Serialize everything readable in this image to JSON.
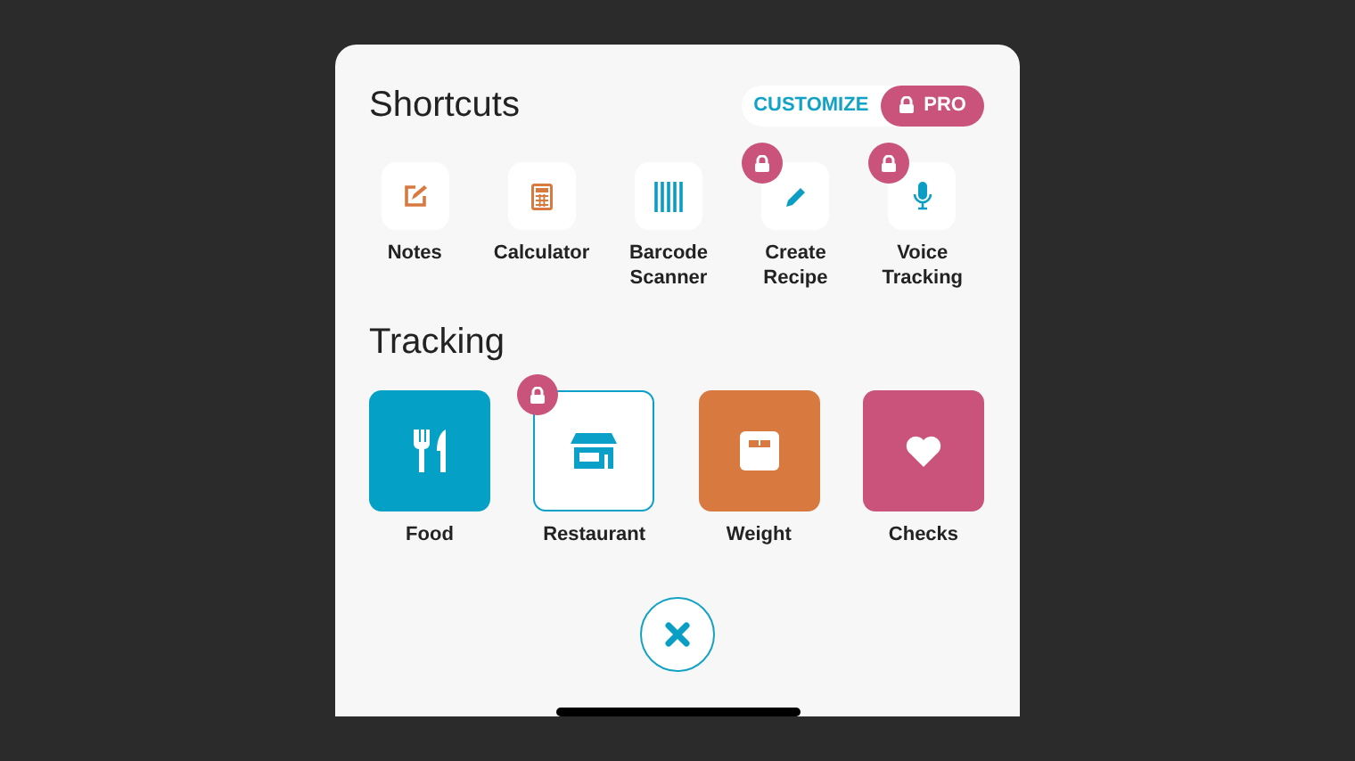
{
  "shortcuts": {
    "title": "Shortcuts",
    "customize": {
      "label": "CUSTOMIZE",
      "badge": "PRO"
    },
    "items": [
      {
        "label": "Notes",
        "kind": "notes",
        "locked": false
      },
      {
        "label": "Calculator",
        "kind": "calculator",
        "locked": false
      },
      {
        "label": "Barcode Scanner",
        "kind": "barcode",
        "locked": false
      },
      {
        "label": "Create Recipe",
        "kind": "recipe",
        "locked": true
      },
      {
        "label": "Voice Tracking",
        "kind": "voice",
        "locked": true
      }
    ]
  },
  "tracking": {
    "title": "Tracking",
    "items": [
      {
        "label": "Food",
        "kind": "food",
        "color": "#05a0c6",
        "locked": false
      },
      {
        "label": "Restaurant",
        "kind": "restaurant",
        "color": "#0aa0c8",
        "locked": true
      },
      {
        "label": "Weight",
        "kind": "weight",
        "color": "#d87a40",
        "locked": false
      },
      {
        "label": "Checks",
        "kind": "checks",
        "color": "#c9537a",
        "locked": false
      }
    ]
  }
}
